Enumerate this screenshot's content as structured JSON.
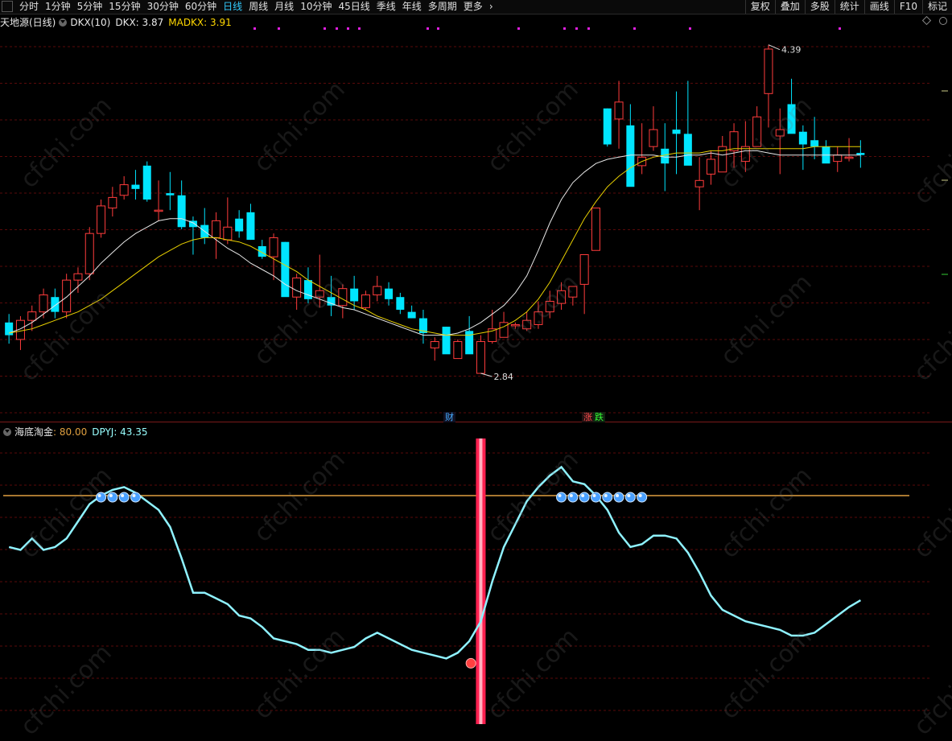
{
  "toolbar": {
    "periods": [
      "分时",
      "1分钟",
      "5分钟",
      "15分钟",
      "30分钟",
      "60分钟",
      "日线",
      "周线",
      "月线",
      "10分钟",
      "45日线",
      "季线",
      "年线",
      "多周期",
      "更多"
    ],
    "active": "日线",
    "more_arrow": "›",
    "right_items": [
      "复权",
      "叠加",
      "多股",
      "统计",
      "画线",
      "F10",
      "标记"
    ]
  },
  "main_legend": {
    "stock": "天地源(日线)",
    "indicator": "DKX(10)",
    "dkx_label": "DKX: 3.87",
    "madkx_label": "MADKX: 3.91"
  },
  "sub_legend": {
    "indicator": "海底淘金",
    "level_label": ": 80.00",
    "dpyj_label": "DPYJ: 43.35"
  },
  "annotations": {
    "high": "4.39",
    "low": "2.84",
    "tag_cai": "财",
    "tag_zhang": "涨",
    "tag_die": "跌"
  },
  "colors": {
    "up": "#ff3c3c",
    "down": "#00e5ff",
    "dkx": "#e8e8e8",
    "madkx": "#e8d000",
    "level": "#e0a040",
    "dpyj": "#8ff2ff",
    "signal": "#ff2050",
    "grid": "#5a0a0a"
  },
  "watermark": "cfchi.com",
  "chart_data": {
    "type": "candlestick",
    "x_count": 75,
    "ohlc": [
      [
        3.08,
        3.12,
        2.98,
        3.02
      ],
      [
        3.0,
        3.11,
        2.95,
        3.09
      ],
      [
        3.09,
        3.16,
        3.04,
        3.13
      ],
      [
        3.13,
        3.24,
        3.1,
        3.21
      ],
      [
        3.2,
        3.24,
        3.1,
        3.13
      ],
      [
        3.13,
        3.31,
        3.1,
        3.28
      ],
      [
        3.28,
        3.34,
        3.22,
        3.31
      ],
      [
        3.31,
        3.53,
        3.28,
        3.5
      ],
      [
        3.5,
        3.66,
        3.48,
        3.63
      ],
      [
        3.62,
        3.72,
        3.58,
        3.67
      ],
      [
        3.68,
        3.77,
        3.66,
        3.73
      ],
      [
        3.73,
        3.8,
        3.66,
        3.71
      ],
      [
        3.82,
        3.84,
        3.65,
        3.66
      ],
      [
        3.61,
        3.75,
        3.56,
        3.61
      ],
      [
        3.69,
        3.79,
        3.61,
        3.68
      ],
      [
        3.68,
        3.75,
        3.52,
        3.53
      ],
      [
        3.56,
        3.58,
        3.4,
        3.53
      ],
      [
        3.54,
        3.62,
        3.45,
        3.48
      ],
      [
        3.48,
        3.6,
        3.38,
        3.56
      ],
      [
        3.47,
        3.67,
        3.45,
        3.53
      ],
      [
        3.57,
        3.61,
        3.48,
        3.51
      ],
      [
        3.6,
        3.64,
        3.47,
        3.47
      ],
      [
        3.44,
        3.47,
        3.38,
        3.39
      ],
      [
        3.39,
        3.5,
        3.28,
        3.48
      ],
      [
        3.46,
        3.46,
        3.25,
        3.2
      ],
      [
        3.2,
        3.31,
        3.14,
        3.29
      ],
      [
        3.28,
        3.34,
        3.17,
        3.19
      ],
      [
        3.2,
        3.4,
        3.15,
        3.23
      ],
      [
        3.2,
        3.3,
        3.11,
        3.16
      ],
      [
        3.16,
        3.26,
        3.1,
        3.24
      ],
      [
        3.24,
        3.3,
        3.14,
        3.18
      ],
      [
        3.15,
        3.23,
        3.14,
        3.21
      ],
      [
        3.21,
        3.3,
        3.18,
        3.25
      ],
      [
        3.24,
        3.27,
        3.16,
        3.19
      ],
      [
        3.2,
        3.22,
        3.12,
        3.14
      ],
      [
        3.13,
        3.16,
        3.1,
        3.1
      ],
      [
        3.1,
        3.14,
        2.98,
        3.03
      ],
      [
        2.96,
        3.01,
        2.9,
        2.99
      ],
      [
        3.06,
        3.06,
        2.96,
        2.93
      ],
      [
        2.91,
        3.0,
        2.91,
        2.99
      ],
      [
        3.04,
        3.11,
        2.97,
        2.93
      ],
      [
        2.84,
        3.02,
        2.84,
        2.99
      ],
      [
        2.99,
        3.14,
        2.98,
        3.05
      ],
      [
        3.01,
        3.13,
        3.01,
        3.08
      ],
      [
        3.07,
        3.08,
        3.05,
        3.07
      ],
      [
        3.05,
        3.13,
        3.04,
        3.09
      ],
      [
        3.07,
        3.18,
        3.05,
        3.13
      ],
      [
        3.13,
        3.23,
        3.1,
        3.18
      ],
      [
        3.17,
        3.27,
        3.14,
        3.23
      ],
      [
        3.2,
        3.25,
        3.16,
        3.25
      ],
      [
        3.26,
        3.4,
        3.12,
        3.4
      ],
      [
        3.42,
        3.62,
        3.42,
        3.62
      ],
      [
        4.09,
        4.09,
        3.91,
        3.92
      ],
      [
        4.04,
        4.22,
        3.9,
        4.12
      ],
      [
        4.01,
        4.11,
        3.78,
        3.72
      ],
      [
        3.82,
        4.02,
        3.78,
        3.86
      ],
      [
        3.91,
        4.1,
        3.89,
        3.99
      ],
      [
        3.9,
        4.02,
        3.7,
        3.83
      ],
      [
        3.99,
        4.17,
        3.78,
        3.97
      ],
      [
        3.97,
        4.22,
        3.91,
        3.82
      ],
      [
        3.72,
        3.86,
        3.61,
        3.75
      ],
      [
        3.78,
        3.89,
        3.73,
        3.85
      ],
      [
        3.79,
        3.96,
        3.82,
        3.91
      ],
      [
        3.89,
        4.02,
        3.81,
        3.98
      ],
      [
        3.84,
        4.03,
        3.79,
        3.91
      ],
      [
        3.91,
        4.1,
        3.91,
        4.05
      ],
      [
        4.16,
        4.39,
        4.0,
        4.37
      ],
      [
        3.96,
        4.09,
        3.78,
        3.99
      ],
      [
        4.11,
        4.23,
        4.05,
        3.97
      ],
      [
        3.98,
        4.01,
        3.8,
        3.92
      ],
      [
        3.94,
        4.05,
        3.85,
        3.91
      ],
      [
        3.91,
        3.94,
        3.86,
        3.83
      ],
      [
        3.84,
        3.91,
        3.79,
        3.87
      ],
      [
        3.86,
        3.95,
        3.84,
        3.86
      ],
      [
        3.88,
        3.94,
        3.81,
        3.87
      ]
    ],
    "dkx": [
      3.03,
      3.05,
      3.08,
      3.12,
      3.16,
      3.2,
      3.25,
      3.3,
      3.36,
      3.41,
      3.46,
      3.5,
      3.53,
      3.56,
      3.57,
      3.57,
      3.55,
      3.51,
      3.47,
      3.43,
      3.4,
      3.36,
      3.33,
      3.3,
      3.26,
      3.23,
      3.21,
      3.19,
      3.17,
      3.15,
      3.14,
      3.12,
      3.1,
      3.08,
      3.06,
      3.04,
      3.02,
      3.02,
      3.02,
      3.03,
      3.05,
      3.08,
      3.12,
      3.16,
      3.22,
      3.3,
      3.42,
      3.55,
      3.66,
      3.74,
      3.79,
      3.83,
      3.85,
      3.86,
      3.87,
      3.87,
      3.87,
      3.86,
      3.86,
      3.87,
      3.87,
      3.88,
      3.87,
      3.88,
      3.89,
      3.89,
      3.88,
      3.87,
      3.87,
      3.87,
      3.87,
      3.87,
      3.87,
      3.87,
      3.87
    ],
    "madkx": [
      3.03,
      3.04,
      3.05,
      3.07,
      3.09,
      3.11,
      3.13,
      3.16,
      3.19,
      3.23,
      3.27,
      3.31,
      3.35,
      3.39,
      3.42,
      3.45,
      3.47,
      3.48,
      3.48,
      3.47,
      3.46,
      3.44,
      3.41,
      3.38,
      3.35,
      3.32,
      3.28,
      3.25,
      3.22,
      3.19,
      3.16,
      3.14,
      3.11,
      3.09,
      3.07,
      3.05,
      3.04,
      3.03,
      3.02,
      3.02,
      3.02,
      3.03,
      3.04,
      3.06,
      3.09,
      3.13,
      3.19,
      3.27,
      3.37,
      3.47,
      3.57,
      3.65,
      3.72,
      3.77,
      3.81,
      3.84,
      3.86,
      3.87,
      3.88,
      3.88,
      3.88,
      3.89,
      3.89,
      3.9,
      3.9,
      3.9,
      3.9,
      3.9,
      3.9,
      3.9,
      3.91,
      3.91,
      3.91,
      3.91,
      3.91
    ],
    "dpyj": [
      62,
      61,
      65,
      61,
      62,
      65,
      71,
      77,
      80,
      82,
      83,
      81,
      78,
      75,
      69,
      58,
      46,
      46,
      44,
      42,
      38,
      37,
      34,
      30,
      29,
      28,
      26,
      26,
      25,
      26,
      27,
      30,
      32,
      30,
      28,
      26,
      25,
      24,
      23,
      25,
      29,
      36,
      50,
      62,
      70,
      78,
      83,
      87,
      90,
      85,
      84,
      80,
      75,
      67,
      62,
      63,
      66,
      66,
      65,
      60,
      53,
      45,
      40,
      38,
      36,
      35,
      34,
      33,
      31,
      31,
      32,
      35,
      38,
      41,
      43.35
    ],
    "level": 80.0,
    "signal_index": 41,
    "bubble_groups": [
      [
        8,
        11
      ],
      [
        48,
        55
      ]
    ],
    "main_ylim": [
      2.62,
      4.48
    ],
    "sub_ylim": [
      0,
      100
    ]
  }
}
